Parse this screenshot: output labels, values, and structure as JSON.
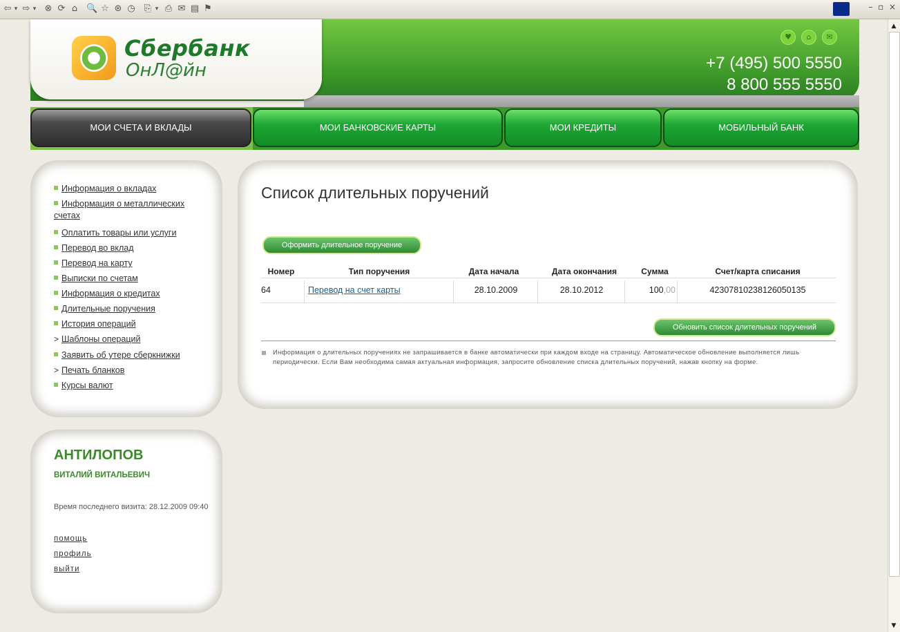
{
  "browser": {
    "toolbar_glyphs": [
      "⇦",
      "▾",
      "⇨",
      "▾",
      "⊗",
      "⟳",
      "⌂",
      "🔍",
      "☆",
      "⊛",
      "◷",
      "⎘",
      "▾",
      "⎙",
      "✉",
      "▤",
      "⚑"
    ]
  },
  "header": {
    "logo_name": "Сбербанк",
    "logo_sub": "ОнЛ@йн",
    "phone_1": "+7 (495) 500 5550",
    "phone_2": "8 800 555 5550",
    "icons": [
      "heart-icon",
      "home-icon",
      "mail-icon"
    ]
  },
  "nav": {
    "tabs": [
      {
        "label": "МОИ СЧЕТА И ВКЛАДЫ",
        "active": true
      },
      {
        "label": "МОИ БАНКОВСКИЕ КАРТЫ",
        "active": false
      },
      {
        "label": "МОИ КРЕДИТЫ",
        "active": false
      },
      {
        "label": "МОБИЛЬНЫЙ БАНК",
        "active": false
      }
    ]
  },
  "sidebar": {
    "items": [
      {
        "label": "Информация о вкладах",
        "marker": "bullet"
      },
      {
        "label": "Информация о металлических счетах",
        "marker": "bullet"
      },
      {
        "label": "Оплатить товары или услуги",
        "marker": "bullet"
      },
      {
        "label": "Перевод во вклад",
        "marker": "bullet"
      },
      {
        "label": "Перевод на карту",
        "marker": "bullet"
      },
      {
        "label": "Выписки по счетам",
        "marker": "bullet"
      },
      {
        "label": "Информация о кредитах",
        "marker": "bullet"
      },
      {
        "label": "Длительные поручения",
        "marker": "bullet"
      },
      {
        "label": "История операций",
        "marker": "bullet"
      },
      {
        "label": "Шаблоны операций",
        "marker": "arrow"
      },
      {
        "label": "Заявить об утере сберкнижки",
        "marker": "bullet"
      },
      {
        "label": "Печать бланков",
        "marker": "arrow"
      },
      {
        "label": "Курсы валют",
        "marker": "bullet"
      }
    ]
  },
  "user": {
    "last_name": "АНТИЛОПОВ",
    "first_name": "ВИТАЛИЙ ВИТАЛЬЕВИЧ",
    "last_visit": "Время последнего визита: 28.12.2009 09:40",
    "links": [
      "помощь",
      "профиль",
      "выйти"
    ]
  },
  "main": {
    "title": "Список длительных поручений",
    "create_button": "Оформить длительное поручение",
    "refresh_button": "Обновить список длительных поручений",
    "table": {
      "headers": [
        "Номер",
        "Тип поручения",
        "Дата начала",
        "Дата окончания",
        "Сумма",
        "Счет/карта списания"
      ],
      "rows": [
        {
          "number": "64",
          "type": "Перевод на счет карты",
          "start": "28.10.2009",
          "end": "28.10.2012",
          "amount_main": "100",
          "amount_cents": ",00",
          "account": "42307810238126050135"
        }
      ]
    },
    "info": "Информация о длительных поручениях не запрашивается в банке автоматически при каждом входе на страницу. Автоматическое обновление выполняется лишь периодически. Если Вам необходима самая актуальная информация, запросите обновление списка длительных поручений, нажав кнопку на форме."
  },
  "colors": {
    "brand_green": "#3e9a2a",
    "link": "#1b5e8c"
  }
}
